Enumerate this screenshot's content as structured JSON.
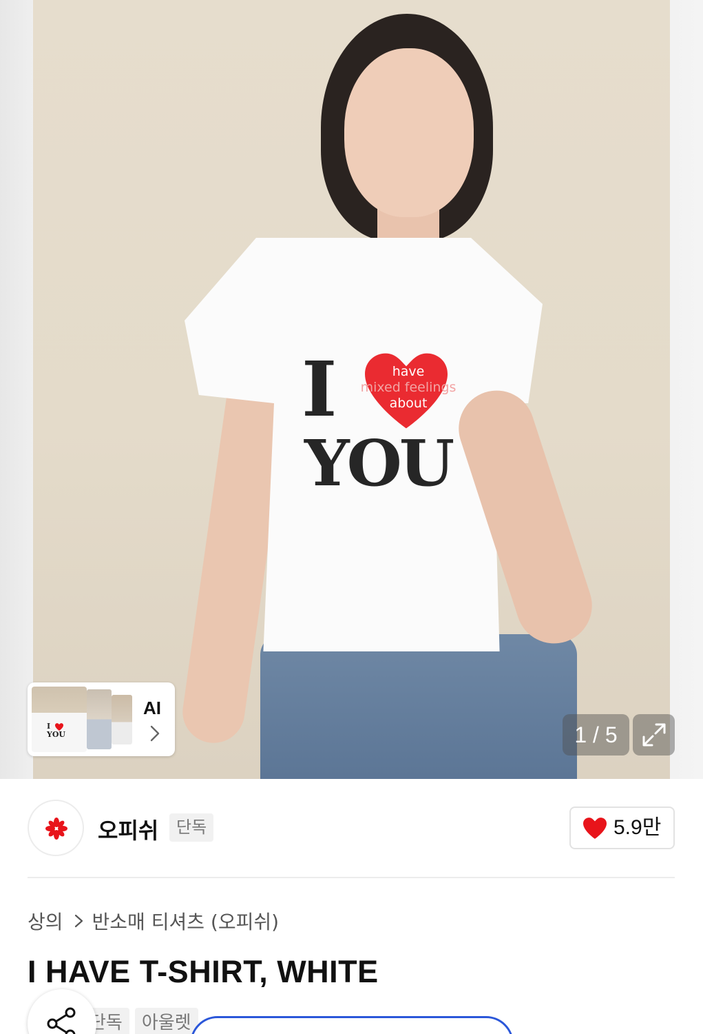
{
  "gallery": {
    "counter": "1 / 5",
    "shirt_print": {
      "big_letter": "I",
      "word": "YOU",
      "heart_line1": "have",
      "heart_line2": "mixed feelings",
      "heart_line3": "about"
    },
    "ai_card": {
      "label": "AI",
      "thumb_print_top": "I",
      "thumb_print_bottom": "YOU"
    }
  },
  "brand": {
    "name": "오피쉬",
    "badge": "단독",
    "likes": "5.9만",
    "heart_color": "#e8141b"
  },
  "breadcrumb": [
    "상의",
    "반소매 티셔츠 (오피쉬)"
  ],
  "product": {
    "title": "I HAVE T-SHIRT, WHITE",
    "tags": [
      "단독",
      "아울렛"
    ]
  },
  "colors": {
    "accent_blue": "#2b57d9",
    "brand_red": "#e8141b"
  }
}
